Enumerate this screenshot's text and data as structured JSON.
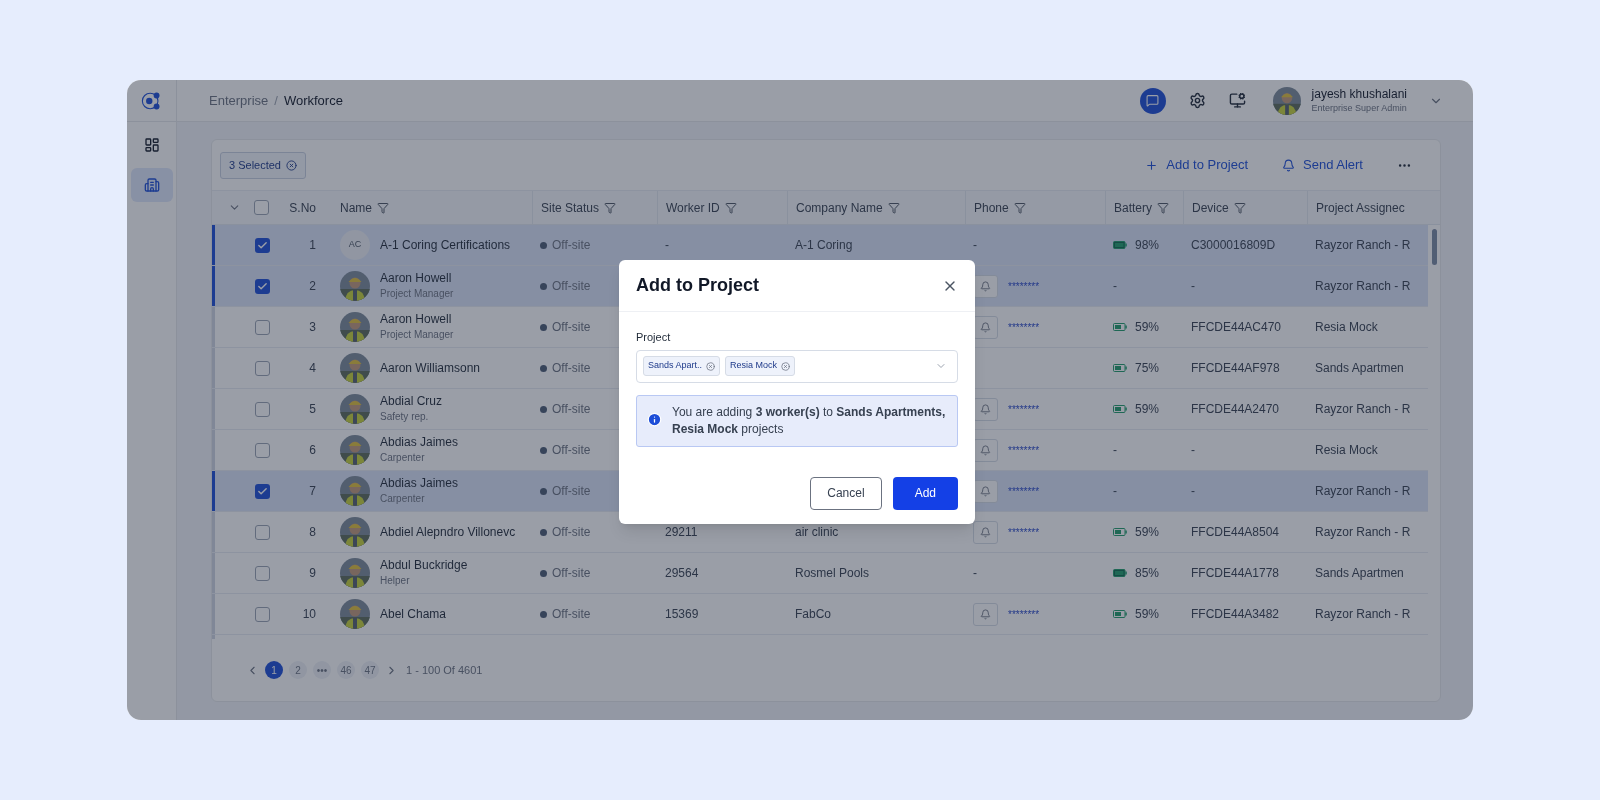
{
  "breadcrumb": {
    "separator": "/",
    "items": [
      {
        "label": "Enterprise",
        "current": false
      },
      {
        "label": "Workforce",
        "current": true
      }
    ]
  },
  "sidebar": {
    "items": [
      {
        "kind": "dashboard",
        "selected": false
      },
      {
        "kind": "buildings",
        "selected": true
      }
    ]
  },
  "user": {
    "name": "jayesh khushalani",
    "role": "Enterprise Super Admin"
  },
  "toolbar": {
    "selection": "3 Selected",
    "actions": [
      {
        "kind": "add",
        "label": "Add to Project"
      },
      {
        "kind": "alert",
        "label": "Send Alert"
      }
    ]
  },
  "table": {
    "all_checked": false,
    "columns": [
      {
        "label": "S.No",
        "filter": false
      },
      {
        "label": "Name",
        "filter": true
      },
      {
        "label": "Site Status",
        "filter": true
      },
      {
        "label": "Worker ID",
        "filter": true
      },
      {
        "label": "Company Name",
        "filter": true
      },
      {
        "label": "Phone",
        "filter": true
      },
      {
        "label": "Battery",
        "filter": true
      },
      {
        "label": "Device",
        "filter": true
      },
      {
        "label": "Project Assignec",
        "filter": false
      }
    ],
    "rows": [
      {
        "selected": true,
        "sno": "1",
        "avatar": {
          "kind": "initials",
          "text": "AC"
        },
        "name": "A-1 Coring Certifications",
        "site_status": "Off-site",
        "worker_id": "-",
        "company": "A-1 Coring",
        "phone": {
          "kind": "text",
          "text": "-"
        },
        "battery": {
          "kind": "full",
          "text": "98%"
        },
        "device": "C3000016809D",
        "project": "Rayzor Ranch - R"
      },
      {
        "selected": true,
        "sno": "2",
        "name": "Aaron Howell",
        "role": "Project Manager",
        "site_status": "Off-site",
        "phone": {
          "kind": "alert",
          "text": "********"
        },
        "battery": {
          "kind": "none",
          "text": "-"
        },
        "device": "-",
        "project": "Rayzor Ranch - R"
      },
      {
        "selected": false,
        "sno": "3",
        "name": "Aaron Howell",
        "role": "Project Manager",
        "site_status": "Off-site",
        "phone": {
          "kind": "alert",
          "text": "********"
        },
        "battery": {
          "kind": "partial",
          "text": "59%"
        },
        "device": "FFCDE44AC470",
        "project": "Resia Mock"
      },
      {
        "selected": false,
        "sno": "4",
        "name": "Aaron Williamsonn",
        "site_status": "Off-site",
        "battery": {
          "kind": "partial",
          "text": "75%"
        },
        "device": "FFCDE44AF978",
        "project": "Sands Apartmen"
      },
      {
        "selected": false,
        "sno": "5",
        "name": "Abdial Cruz",
        "role": "Safety rep.",
        "site_status": "Off-site",
        "phone": {
          "kind": "alert",
          "text": "********"
        },
        "battery": {
          "kind": "partial",
          "text": "59%"
        },
        "device": "FFCDE44A2470",
        "project": "Rayzor Ranch - R"
      },
      {
        "selected": false,
        "sno": "6",
        "name": "Abdias Jaimes",
        "role": "Carpenter",
        "site_status": "Off-site",
        "phone": {
          "kind": "alert",
          "text": "********"
        },
        "battery": {
          "kind": "none",
          "text": "-"
        },
        "device": "-",
        "project": "Resia Mock"
      },
      {
        "selected": true,
        "sno": "7",
        "name": "Abdias Jaimes",
        "role": "Carpenter",
        "site_status": "Off-site",
        "phone": {
          "kind": "alert",
          "text": "********"
        },
        "battery": {
          "kind": "none",
          "text": "-"
        },
        "device": "-",
        "project": "Rayzor Ranch - R"
      },
      {
        "selected": false,
        "sno": "8",
        "name": "Abdiel Alepndro Villonevc",
        "site_status": "Off-site",
        "worker_id": "29211",
        "company": "air clinic",
        "phone": {
          "kind": "alert",
          "text": "********"
        },
        "battery": {
          "kind": "partial",
          "text": "59%"
        },
        "device": "FFCDE44A8504",
        "project": "Rayzor Ranch - R"
      },
      {
        "selected": false,
        "sno": "9",
        "name": "Abdul Buckridge",
        "role": "Helper",
        "site_status": "Off-site",
        "worker_id": "29564",
        "company": "Rosmel Pools",
        "phone": {
          "kind": "text",
          "text": "-"
        },
        "battery": {
          "kind": "full",
          "text": "85%"
        },
        "device": "FFCDE44A1778",
        "project": "Sands Apartmen"
      },
      {
        "selected": false,
        "sno": "10",
        "name": "Abel Chama",
        "site_status": "Off-site",
        "worker_id": "15369",
        "company": "FabCo",
        "phone": {
          "kind": "alert",
          "text": "********"
        },
        "battery": {
          "kind": "partial",
          "text": "59%"
        },
        "device": "FFCDE44A3482",
        "project": "Rayzor Ranch - R"
      }
    ]
  },
  "pagination": {
    "pages": [
      {
        "label": "1",
        "selected": true
      },
      {
        "label": "2",
        "selected": false
      },
      {
        "label": "•••",
        "selected": false
      },
      {
        "label": "46",
        "selected": false
      },
      {
        "label": "47",
        "selected": false
      }
    ],
    "summary": "1 - 100 Of 4601"
  },
  "dialog": {
    "title": "Add to Project",
    "field_label": "Project",
    "tags": [
      "Sands Apart..",
      "Resia Mock"
    ],
    "message": "You are adding **3 worker(s)** to **Sands Apartments, Resia Mock** projects",
    "buttons": [
      {
        "kind": "secondary",
        "label": "Cancel"
      },
      {
        "kind": "primary",
        "label": "Add"
      }
    ]
  }
}
